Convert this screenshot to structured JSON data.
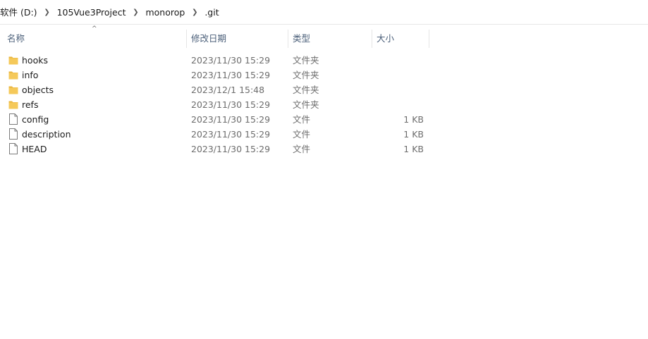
{
  "breadcrumb": {
    "items": [
      "软件 (D:)",
      "105Vue3Project",
      "monorop",
      ".git"
    ]
  },
  "columns": {
    "name": "名称",
    "date": "修改日期",
    "type": "类型",
    "size": "大小",
    "sort_indicator": "^"
  },
  "files": [
    {
      "name": "hooks",
      "date": "2023/11/30 15:29",
      "type": "文件夹",
      "size": "",
      "icon": "folder-icon"
    },
    {
      "name": "info",
      "date": "2023/11/30 15:29",
      "type": "文件夹",
      "size": "",
      "icon": "folder-icon"
    },
    {
      "name": "objects",
      "date": "2023/12/1 15:48",
      "type": "文件夹",
      "size": "",
      "icon": "folder-icon"
    },
    {
      "name": "refs",
      "date": "2023/11/30 15:29",
      "type": "文件夹",
      "size": "",
      "icon": "folder-icon"
    },
    {
      "name": "config",
      "date": "2023/11/30 15:29",
      "type": "文件",
      "size": "1 KB",
      "icon": "file-icon"
    },
    {
      "name": "description",
      "date": "2023/11/30 15:29",
      "type": "文件",
      "size": "1 KB",
      "icon": "file-icon"
    },
    {
      "name": "HEAD",
      "date": "2023/11/30 15:29",
      "type": "文件",
      "size": "1 KB",
      "icon": "file-icon"
    }
  ],
  "colors": {
    "folder": "#f5c95a",
    "folder_shade": "#e9b43b",
    "header_text": "#4c607a",
    "meta_text": "#6d6d6d"
  }
}
